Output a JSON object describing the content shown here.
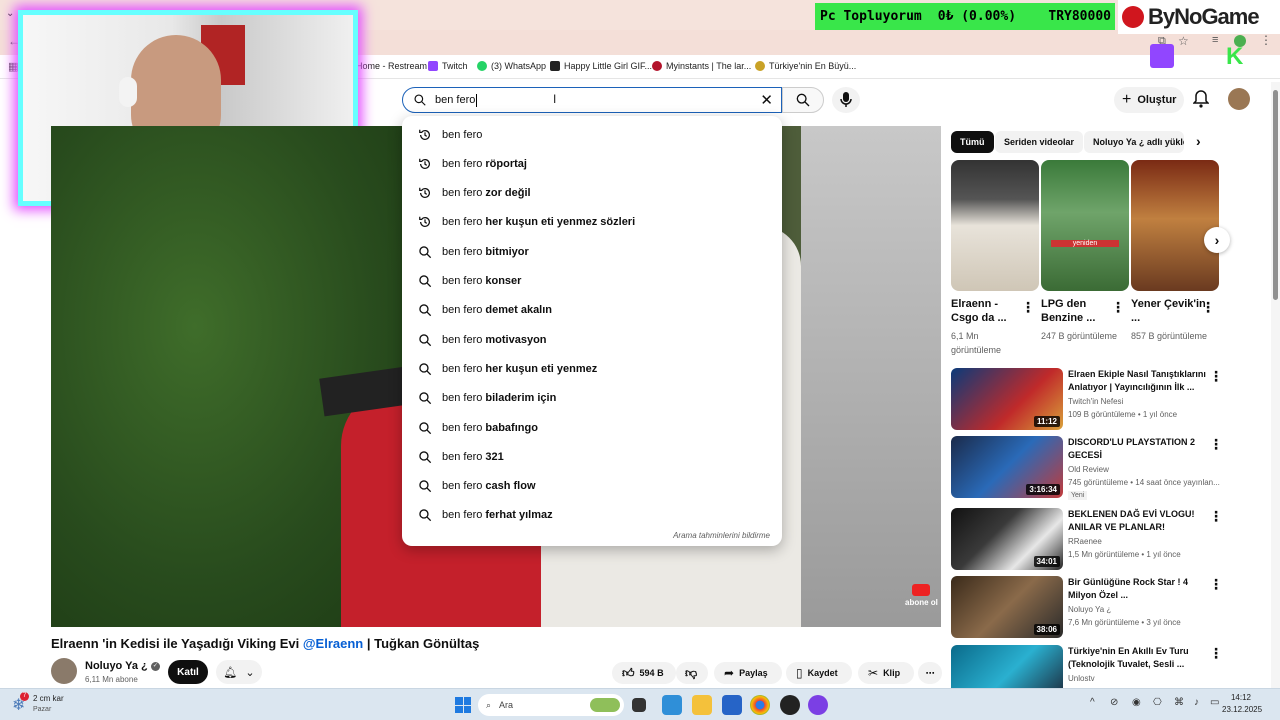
{
  "browser": {
    "bookmarks": [
      "Home - Restream",
      "Twitch",
      "(3) WhatsApp",
      "Happy Little Girl GIF...",
      "Myinstants | The lar...",
      "Türkiye'nin En Büyü..."
    ]
  },
  "overlay": {
    "ticker_name": "Pc Topluyorum",
    "ticker_amount": "0₺ (0.00%)",
    "ticker_goal": "TRY80000",
    "brand": "ByNoGame"
  },
  "header": {
    "search_value": "ben fero",
    "create_label": "Oluştur"
  },
  "suggestions": [
    {
      "prefix": "ben fero",
      "suffix": "",
      "icon": "history-icon"
    },
    {
      "prefix": "ben fero",
      "suffix": "röportaj",
      "icon": "history-icon"
    },
    {
      "prefix": "ben fero",
      "suffix": "zor değil",
      "icon": "history-icon"
    },
    {
      "prefix": "ben fero",
      "suffix": "her kuşun eti yenmez sözleri",
      "icon": "history-icon"
    },
    {
      "prefix": "ben fero",
      "suffix": "bitmiyor",
      "icon": "search-icon"
    },
    {
      "prefix": "ben fero",
      "suffix": "konser",
      "icon": "search-icon"
    },
    {
      "prefix": "ben fero",
      "suffix": "demet akalın",
      "icon": "search-icon"
    },
    {
      "prefix": "ben fero",
      "suffix": "motivasyon",
      "icon": "search-icon"
    },
    {
      "prefix": "ben fero",
      "suffix": "her kuşun eti yenmez",
      "icon": "search-icon"
    },
    {
      "prefix": "ben fero",
      "suffix": "biladerim için",
      "icon": "search-icon"
    },
    {
      "prefix": "ben fero",
      "suffix": "babafıngo",
      "icon": "search-icon"
    },
    {
      "prefix": "ben fero",
      "suffix": "321",
      "icon": "search-icon"
    },
    {
      "prefix": "ben fero",
      "suffix": "cash flow",
      "icon": "search-icon"
    },
    {
      "prefix": "ben fero",
      "suffix": "ferhat yılmaz",
      "icon": "search-icon"
    }
  ],
  "report_label": "Arama tahminlerini bildirme",
  "video": {
    "title_pre": "Elraenn 'in Kedisi ile Yaşadığı Viking Evi ",
    "title_tag": "@Elraenn",
    "title_post": " | Tuğkan Gönültaş",
    "overlay_text": "abone ol",
    "channel_name": "Noluyo Ya ¿",
    "subscribers": "6,11 Mn abone",
    "join_label": "Katıl",
    "likes": "594 B",
    "share_label": "Paylaş",
    "save_label": "Kaydet",
    "clip_label": "Klip"
  },
  "chips": [
    "Tümü",
    "Seriden videolar",
    "Noluyo Ya ¿ adlı yükle"
  ],
  "shorts": [
    {
      "title": "Elraenn - Csgo da ...",
      "views": "6,1 Mn görüntüleme"
    },
    {
      "title": "LPG den Benzine ...",
      "views": "247 B görüntüleme"
    },
    {
      "title": "Yener Çevik'in ...",
      "views": "857 B görüntüleme"
    }
  ],
  "recommendations": [
    {
      "title": "Elraen Ekiple Nasıl Tanıştıklarını Anlatıyor | Yayıncılığının İlk ...",
      "channel": "Twitch'in Nefesi",
      "views": "109 B görüntüleme • 1 yıl önce",
      "duration": "11:12",
      "badge": ""
    },
    {
      "title": "DISCORD'LU PLAYSTATION 2 GECESİ",
      "channel": "Old Review",
      "views": "745 görüntüleme • 14 saat önce yayınlan...",
      "duration": "3:16:34",
      "badge": "Yeni"
    },
    {
      "title": "BEKLENEN DAĞ EVİ VLOGU! ANILAR VE PLANLAR!",
      "channel": "RRaenee",
      "views": "1,5 Mn görüntüleme • 1 yıl önce",
      "duration": "34:01",
      "badge": ""
    },
    {
      "title": "Bir Günlüğüne Rock Star ! 4 Milyon Özel ...",
      "channel": "Noluyo Ya ¿",
      "views": "7,6 Mn görüntüleme • 3 yıl önce",
      "duration": "38:06",
      "badge": ""
    },
    {
      "title": "Türkiye'nin En Akıllı Ev Turu (Teknolojik Tuvalet, Sesli ...",
      "channel": "Unlostv",
      "views": "",
      "duration": "",
      "badge": ""
    }
  ],
  "taskbar": {
    "weather_temp": "2 cm kar",
    "weather_day": "Pazar",
    "weather_badge": "7",
    "search_placeholder": "Ara",
    "time": "14:12",
    "date": "23.12.2025"
  },
  "colors": {
    "accent_blue": "#065fd4",
    "ticker_green": "#39e64a",
    "webcam_cyan": "#66ffff",
    "webcam_magenta": "#e24cff",
    "brand_red": "#d0161e"
  }
}
